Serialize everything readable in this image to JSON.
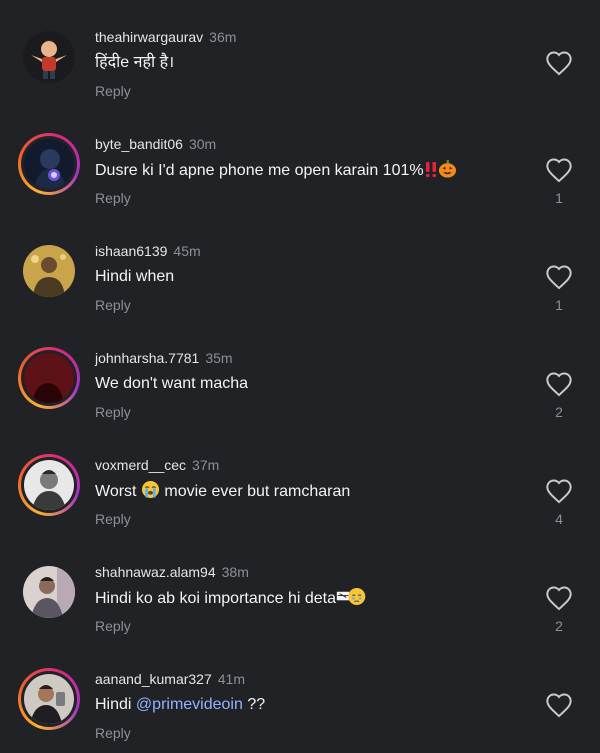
{
  "comments": [
    {
      "username": "theahirwargaurav",
      "time": "36m",
      "text": "हिंदीe नही है।",
      "reply_label": "Reply",
      "likes": ""
    },
    {
      "username": "byte_bandit06",
      "time": "30m",
      "text": "Dusre ki I'd apne phone me open karain 101%",
      "emojis": [
        "double-exclamation-icon",
        "jack-o-lantern-icon"
      ],
      "reply_label": "Reply",
      "likes": "1"
    },
    {
      "username": "ishaan6139",
      "time": "45m",
      "text": "Hindi when",
      "reply_label": "Reply",
      "likes": "1"
    },
    {
      "username": "johnharsha.7781",
      "time": "35m",
      "text": "We don't want macha",
      "reply_label": "Reply",
      "likes": "2"
    },
    {
      "username": "voxmerd__cec",
      "time": "37m",
      "text_before": "Worst",
      "text_after": "movie ever but ramcharan",
      "emojis": [
        "loudly-crying-face-icon"
      ],
      "reply_label": "Reply",
      "likes": "4"
    },
    {
      "username": "shahnawaz.alam94",
      "time": "38m",
      "text": "Hindi ko ab koi importance hi deta",
      "emojis": [
        "face-holding-back-tears-icon"
      ],
      "reply_label": "Reply",
      "likes": "2"
    },
    {
      "username": "aanand_kumar327",
      "time": "41m",
      "text_before": "Hindi",
      "mention": "@primevideoin",
      "text_after": "??",
      "reply_label": "Reply",
      "likes": ""
    }
  ],
  "colors": {
    "background": "#212226",
    "secondary_text": "#8d8f95",
    "mention": "#8fb4ff",
    "story_ring": [
      "#f9b233",
      "#f2602c",
      "#d8287e",
      "#a233c9"
    ]
  }
}
